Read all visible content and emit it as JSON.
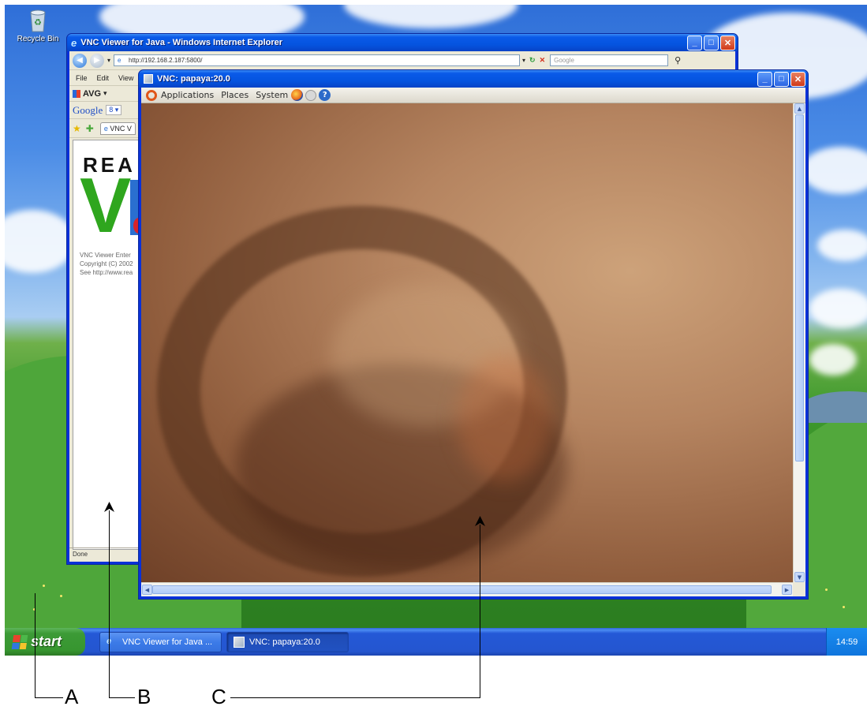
{
  "desktop": {
    "recycle_bin_label": "Recycle Bin"
  },
  "ie_window": {
    "title": "VNC Viewer for Java - Windows Internet Explorer",
    "address": "http://192.168.2.187:5800/",
    "search_placeholder": "Google",
    "menu": [
      "File",
      "Edit",
      "View"
    ],
    "avg_label": "AVG",
    "google_label": "Google",
    "tab_label": "VNC V",
    "logo_text": "REA",
    "logo_letter": "V",
    "info_lines": [
      "VNC Viewer Enter",
      "Copyright (C) 2002",
      "See http://www.rea"
    ],
    "status": "Done"
  },
  "vnc_window": {
    "title": "VNC: papaya:20.0",
    "panel": {
      "applications": "Applications",
      "places": "Places",
      "system": "System"
    }
  },
  "taskbar": {
    "start_label": "start",
    "tasks": [
      {
        "label": "VNC Viewer for Java ...",
        "icon": "ie-icon"
      },
      {
        "label": "VNC: papaya:20.0",
        "icon": "vnc-icon"
      }
    ],
    "clock": "14:59"
  },
  "callouts": {
    "a": "A",
    "b": "B",
    "c": "C"
  },
  "colors": {
    "xp_blue": "#0a5ae8",
    "start_green": "#3c9a36",
    "tray_blue": "#0f75dd"
  }
}
